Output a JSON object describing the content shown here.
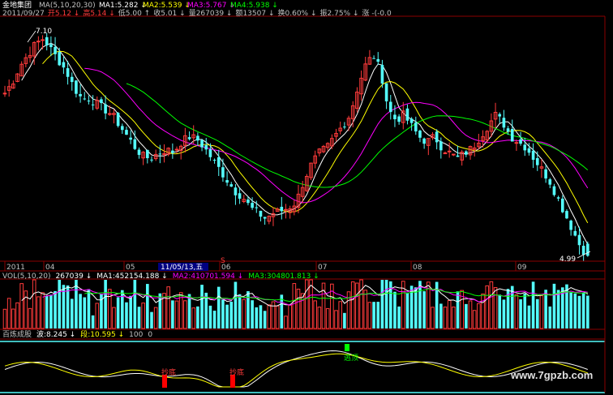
{
  "colors": {
    "background": "#000000",
    "grid": "#8b0000",
    "up": "#ff3b3b",
    "down": "#54fcfc",
    "ma1": "#ffffff",
    "ma2": "#ffff00",
    "ma3": "#ff00ff",
    "ma4": "#00ff00",
    "text": "#c0c0c0",
    "label_bg": "#000080",
    "buy": "#ff0000",
    "sell": "#00ff00"
  },
  "header": {
    "title": "金地集团",
    "ma_params": "MA(5,10,20,30)",
    "ma1": "MA1:5.282 ↓",
    "ma2": "MA2:5.539 ↓",
    "ma3": "MA3:5.767 ↓",
    "ma4": "MA4:5.938 ↓",
    "row2": [
      {
        "text": "2011/09/27",
        "color": "#c0c0c0"
      },
      {
        "text": "开5.12 ↓",
        "color": "#ff3b3b"
      },
      {
        "text": "高5.14 ↓",
        "color": "#ff3b3b"
      },
      {
        "text": "低5.00 ↑",
        "color": "#c0c0c0"
      },
      {
        "text": "收5.01 ↓",
        "color": "#c0c0c0"
      },
      {
        "text": "量267039 ↓",
        "color": "#c0c0c0"
      },
      {
        "text": "额13507 ↓",
        "color": "#c0c0c0"
      },
      {
        "text": "换0.60% ↓",
        "color": "#c0c0c0"
      },
      {
        "text": "振2.75% ↓",
        "color": "#c0c0c0"
      },
      {
        "text": "涨 -(-0.0",
        "color": "#c0c0c0"
      }
    ]
  },
  "price_panel": {
    "high_label": "7.10",
    "low_label": "4.99",
    "cursor_date": "11/05/13,五",
    "marker_S": "S",
    "x_labels": [
      "2011",
      "04",
      "05",
      "06",
      "07",
      "08",
      "09"
    ]
  },
  "vol_panel": {
    "legend": [
      {
        "text": "VOL(5,10,20)",
        "color": "#c0c0c0"
      },
      {
        "text": "267039 ↓",
        "color": "#ffffff"
      },
      {
        "text": "MA1:452154.188 ↓",
        "color": "#ffffff"
      },
      {
        "text": "MA2:410701.594 ↓",
        "color": "#ff00ff"
      },
      {
        "text": "MA3:304801.813 ↓",
        "color": "#00ff00"
      }
    ]
  },
  "ind_panel": {
    "legend": [
      {
        "text": "百炼成股",
        "color": "#c0c0c0"
      },
      {
        "text": "波:8.245 ↓",
        "color": "#ffffff"
      },
      {
        "text": "段:10.595 ↓",
        "color": "#ffff00"
      },
      {
        "text": "100",
        "color": "#c0c0c0"
      },
      {
        "text": "0",
        "color": "#c0c0c0"
      }
    ],
    "buy_label": "抄底",
    "sell_label": "逃顶",
    "watermark": "www.7gpzb.com"
  },
  "chart_data": {
    "type": "candlestick",
    "title": "金地集团",
    "x_labels": [
      "2011",
      "04",
      "05",
      "06",
      "07",
      "08",
      "09"
    ],
    "price_range": [
      4.99,
      7.1
    ],
    "last_bar": {
      "date": "2011/09/27",
      "open": 5.12,
      "high": 5.14,
      "low": 5.0,
      "close": 5.01,
      "volume": 267039,
      "amount": 13507,
      "turnover_pct": 0.6,
      "amplitude_pct": 2.75
    },
    "close_path": [
      6.5,
      6.6,
      6.75,
      6.85,
      6.95,
      7.0,
      6.9,
      6.8,
      6.7,
      6.55,
      6.45,
      6.45,
      6.4,
      6.35,
      6.3,
      6.2,
      6.1,
      6.0,
      5.92,
      5.9,
      5.95,
      5.98,
      5.96,
      6.05,
      6.1,
      6.08,
      6.0,
      5.9,
      5.8,
      5.7,
      5.6,
      5.55,
      5.45,
      5.4,
      5.35,
      5.4,
      5.42,
      5.45,
      5.5,
      5.7,
      5.85,
      5.95,
      6.0,
      6.1,
      6.2,
      6.3,
      6.55,
      6.75,
      6.85,
      6.7,
      6.35,
      6.25,
      6.3,
      6.2,
      6.1,
      6.05,
      6.1,
      6.0,
      5.95,
      5.9,
      5.95,
      6.0,
      6.1,
      6.2,
      6.3,
      6.22,
      6.1,
      6.05,
      6.0,
      5.9,
      5.8,
      5.7,
      5.55,
      5.4,
      5.25,
      5.1,
      5.01
    ],
    "indicator_extremes": {
      "troughs_buy": 2,
      "peaks_sell": 1
    }
  }
}
